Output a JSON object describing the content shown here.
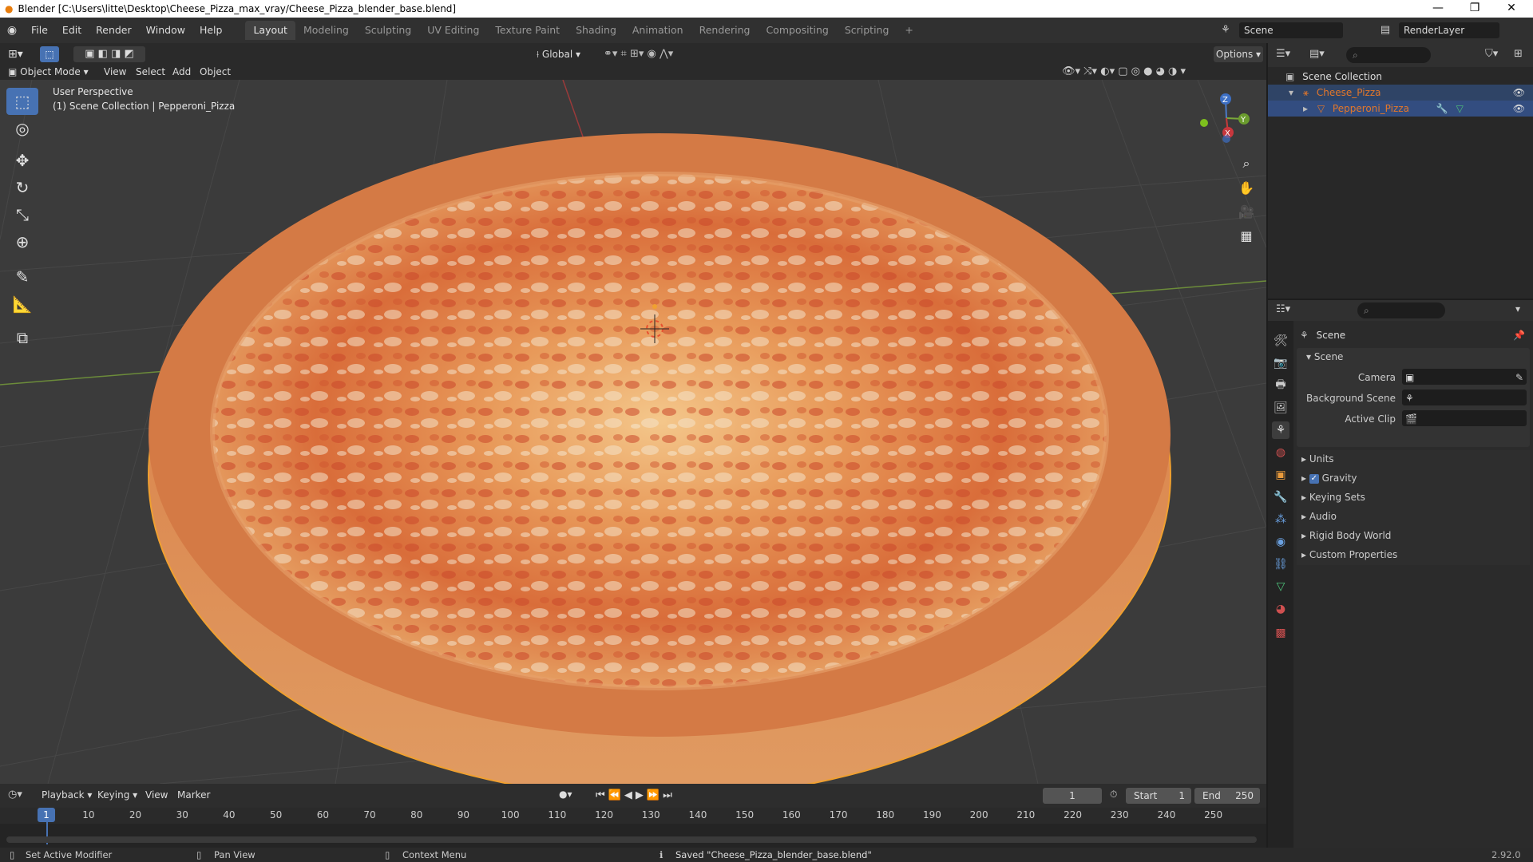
{
  "window": {
    "title": "Blender [C:\\Users\\litte\\Desktop\\Cheese_Pizza_max_vray/Cheese_Pizza_blender_base.blend]",
    "minimize": "—",
    "restore": "❐",
    "close": "✕"
  },
  "menus": [
    "File",
    "Edit",
    "Render",
    "Window",
    "Help"
  ],
  "workspaces": [
    "Layout",
    "Modeling",
    "Sculpting",
    "UV Editing",
    "Texture Paint",
    "Shading",
    "Animation",
    "Rendering",
    "Compositing",
    "Scripting"
  ],
  "active_workspace": "Layout",
  "add_workspace": "+",
  "scene_field": "Scene",
  "renderlayer_field": "RenderLayer",
  "viewport_header": {
    "mode": "Object Mode",
    "menu": [
      "View",
      "Select",
      "Add",
      "Object"
    ],
    "transform_orientation": "Global",
    "options": "Options"
  },
  "viewport": {
    "line1": "User Perspective",
    "line2": "(1) Scene Collection | Pepperoni_Pizza",
    "axis_z": "Z",
    "axis_y": "Y",
    "axis_x": "X"
  },
  "outliner": {
    "root": "Scene Collection",
    "items": [
      {
        "label": "Cheese_Pizza",
        "color": "#e3772a"
      },
      {
        "label": "Pepperoni_Pizza",
        "color": "#e3772a"
      }
    ]
  },
  "properties": {
    "header": "Scene",
    "panel": "Scene",
    "fields": [
      {
        "label": "Camera"
      },
      {
        "label": "Background Scene"
      },
      {
        "label": "Active Clip"
      }
    ],
    "subpanels": [
      {
        "label": "Units",
        "checkbox": false
      },
      {
        "label": "Gravity",
        "checkbox": true
      },
      {
        "label": "Keying Sets",
        "checkbox": false
      },
      {
        "label": "Audio",
        "checkbox": false
      },
      {
        "label": "Rigid Body World",
        "checkbox": false
      },
      {
        "label": "Custom Properties",
        "checkbox": false
      }
    ]
  },
  "timeline": {
    "menu": [
      "Playback",
      "Keying",
      "View",
      "Marker"
    ],
    "current_frame": "1",
    "start_label": "Start",
    "start": "1",
    "end_label": "End",
    "end": "250",
    "ticks": [
      "1",
      "10",
      "20",
      "30",
      "40",
      "50",
      "60",
      "70",
      "80",
      "90",
      "100",
      "110",
      "120",
      "130",
      "140",
      "150",
      "160",
      "170",
      "180",
      "190",
      "200",
      "210",
      "220",
      "230",
      "240",
      "250"
    ]
  },
  "statusbar": {
    "left": "Set Active Modifier",
    "mid": "Pan View",
    "right": "Context Menu",
    "message": "Saved \"Cheese_Pizza_blender_base.blend\"",
    "version": "2.92.0"
  },
  "colors": {
    "accent_blue": "#4772b3",
    "selection_orange": "#f0a030",
    "active_item": "#334d80"
  }
}
